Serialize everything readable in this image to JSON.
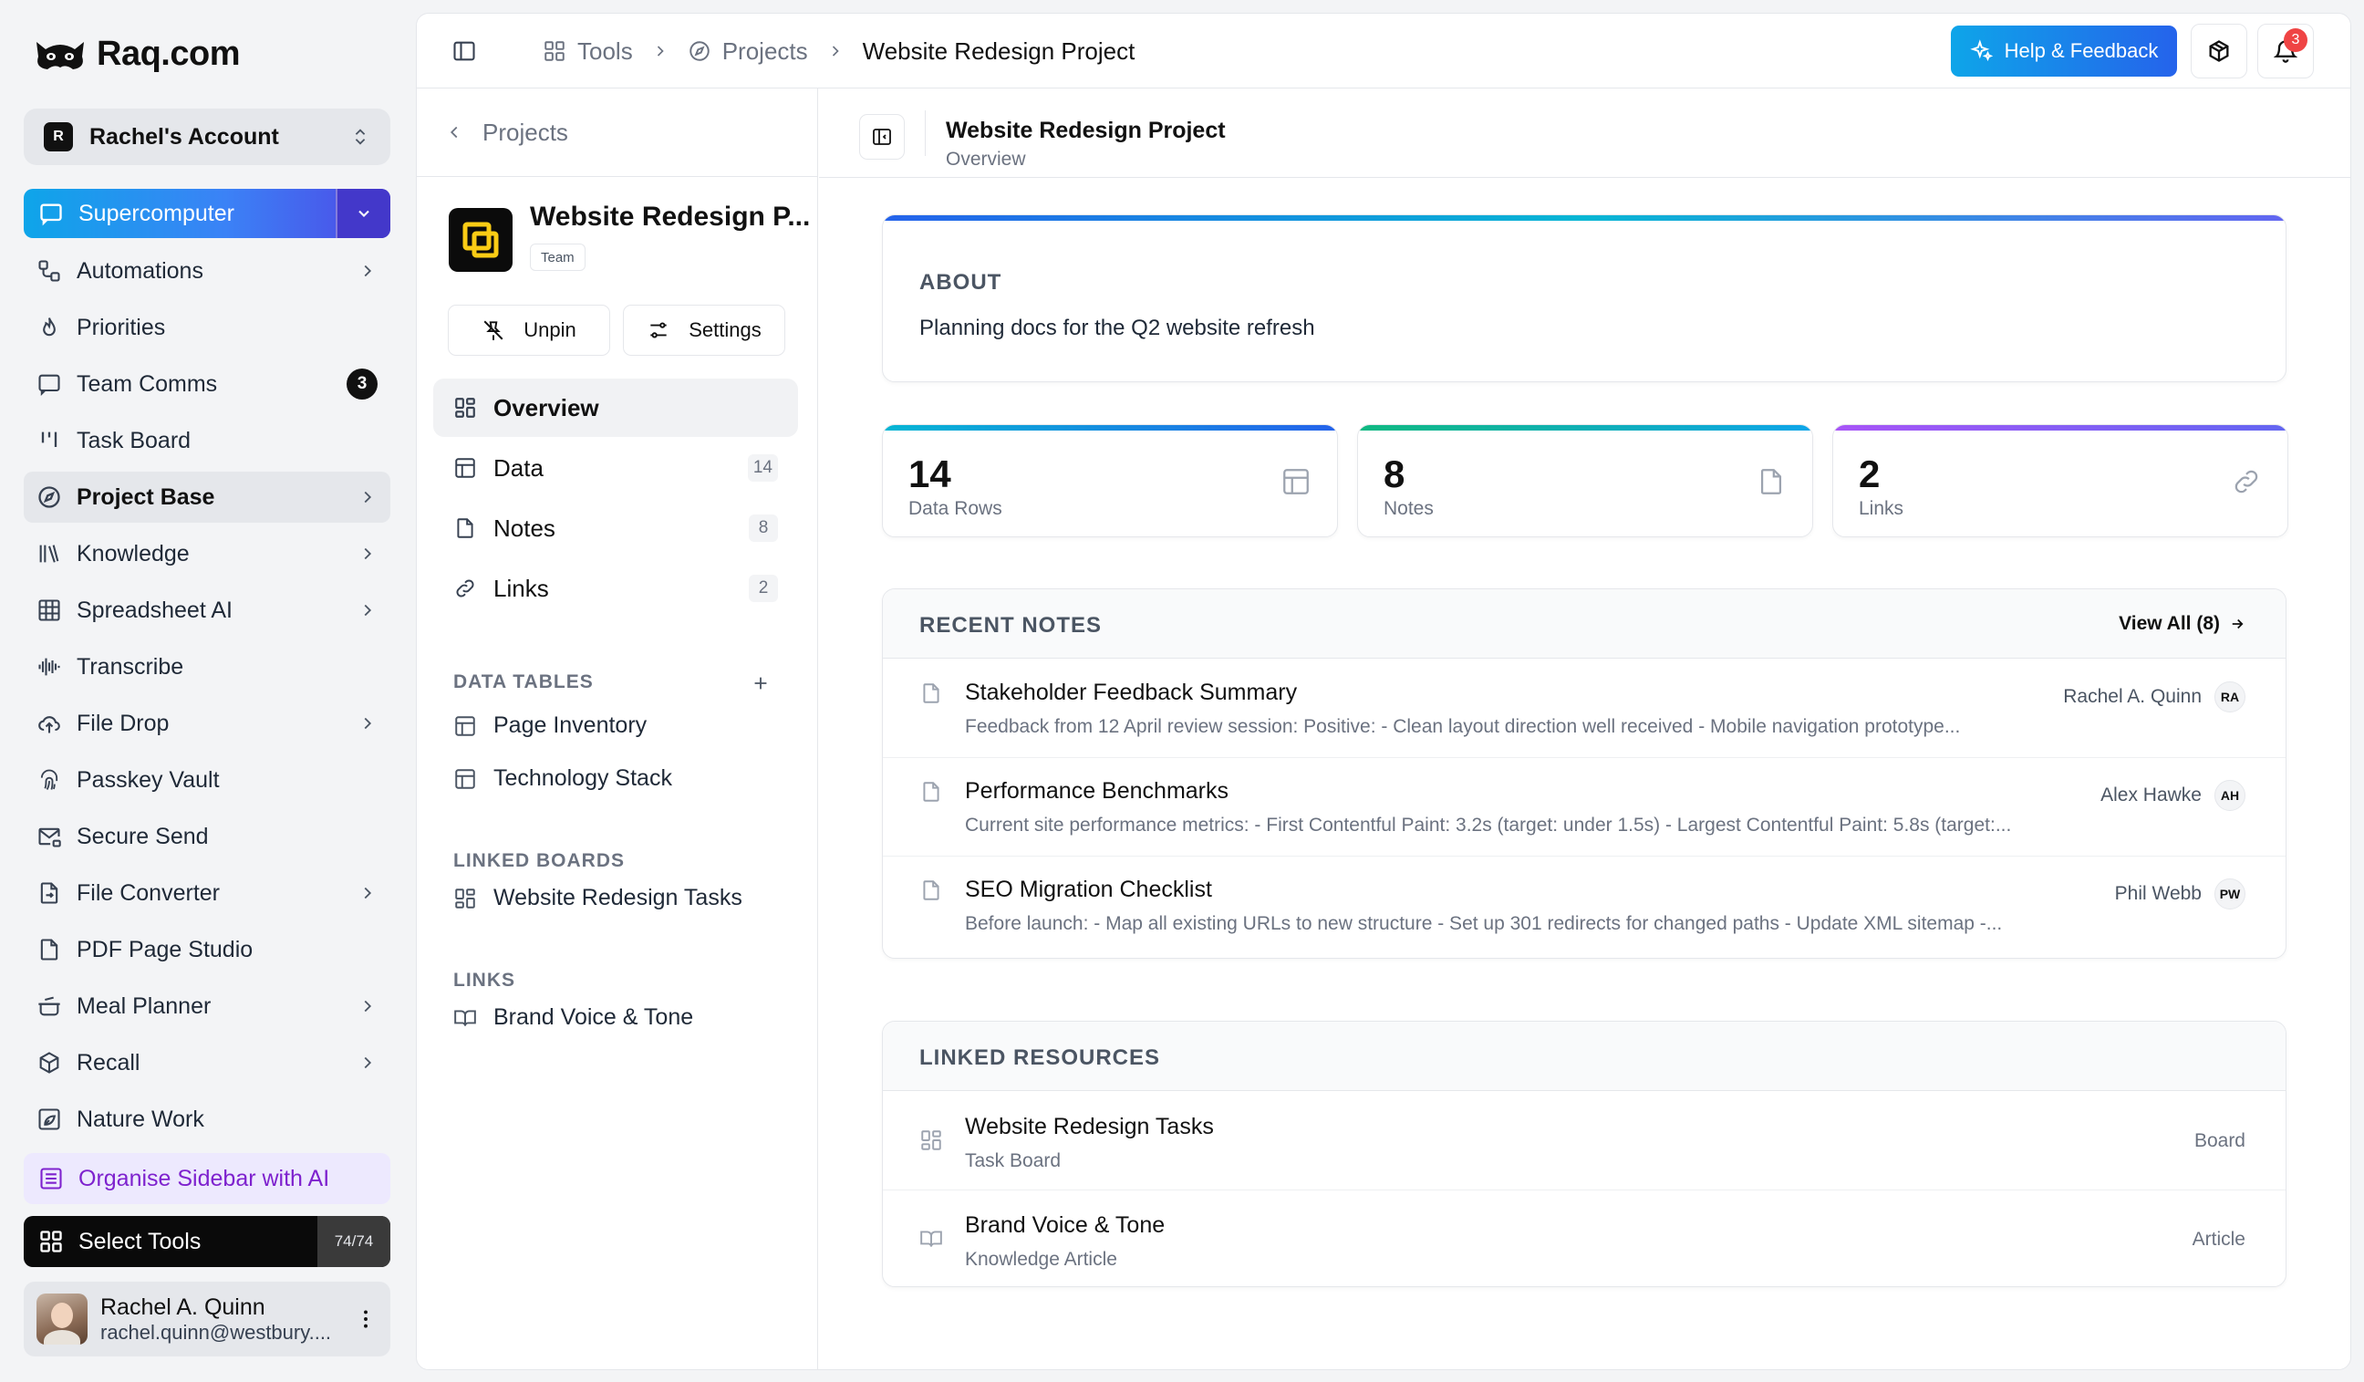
{
  "brand": {
    "name": "Raq.com"
  },
  "account": {
    "initial": "R",
    "name": "Rachel's Account"
  },
  "supercomputer": {
    "label": "Supercomputer"
  },
  "nav": [
    {
      "label": "Automations",
      "icon": "automations-icon",
      "chevron": true
    },
    {
      "label": "Priorities",
      "icon": "flame-icon",
      "chevron": false
    },
    {
      "label": "Team Comms",
      "icon": "chat-icon",
      "count": "3"
    },
    {
      "label": "Task Board",
      "icon": "kanban-icon",
      "chevron": false
    },
    {
      "label": "Project Base",
      "icon": "compass-icon",
      "chevron": true,
      "active": true
    },
    {
      "label": "Knowledge",
      "icon": "library-icon",
      "chevron": true
    },
    {
      "label": "Spreadsheet AI",
      "icon": "grid-icon",
      "chevron": true
    },
    {
      "label": "Transcribe",
      "icon": "waveform-icon",
      "chevron": false
    },
    {
      "label": "File Drop",
      "icon": "cloud-upload-icon",
      "chevron": true
    },
    {
      "label": "Passkey Vault",
      "icon": "fingerprint-icon",
      "chevron": false
    },
    {
      "label": "Secure Send",
      "icon": "mail-lock-icon",
      "chevron": false
    },
    {
      "label": "File Converter",
      "icon": "file-convert-icon",
      "chevron": true
    },
    {
      "label": "PDF Page Studio",
      "icon": "pdf-icon",
      "chevron": false
    },
    {
      "label": "Meal Planner",
      "icon": "cooking-pot-icon",
      "chevron": true
    },
    {
      "label": "Recall",
      "icon": "package-icon",
      "chevron": true
    },
    {
      "label": "Nature Work",
      "icon": "image-leaf-icon",
      "chevron": false
    }
  ],
  "organise": {
    "label": "Organise Sidebar with AI"
  },
  "select_tools": {
    "label": "Select Tools",
    "count": "74/74"
  },
  "user": {
    "name": "Rachel A. Quinn",
    "email": "rachel.quinn@westbury...."
  },
  "breadcrumbs": [
    {
      "label": "Tools"
    },
    {
      "label": "Projects"
    },
    {
      "label": "Website Redesign Project"
    }
  ],
  "help": {
    "label": "Help & Feedback"
  },
  "notifications": {
    "count": "3"
  },
  "project_side": {
    "back_label": "Projects",
    "title": "Website Redesign P...",
    "tag": "Team",
    "unpin_label": "Unpin",
    "settings_label": "Settings",
    "nav": [
      {
        "label": "Overview",
        "count": ""
      },
      {
        "label": "Data",
        "count": "14"
      },
      {
        "label": "Notes",
        "count": "8"
      },
      {
        "label": "Links",
        "count": "2"
      }
    ],
    "data_tables_heading": "DATA TABLES",
    "data_tables": [
      "Page Inventory",
      "Technology Stack"
    ],
    "linked_boards_heading": "LINKED BOARDS",
    "linked_boards": [
      "Website Redesign Tasks"
    ],
    "links_heading": "LINKS",
    "links": [
      "Brand Voice & Tone"
    ]
  },
  "content_header": {
    "title": "Website Redesign Project",
    "subtitle": "Overview"
  },
  "about": {
    "heading": "ABOUT",
    "text": "Planning docs for the Q2 website refresh"
  },
  "stats": [
    {
      "value": "14",
      "label": "Data Rows",
      "color": "#2563eb"
    },
    {
      "value": "8",
      "label": "Notes",
      "color": "#0d9488"
    },
    {
      "value": "2",
      "label": "Links",
      "color": "#8b5cf6"
    }
  ],
  "recent_notes": {
    "heading": "RECENT NOTES",
    "view_all": "View All (8)",
    "items": [
      {
        "title": "Stakeholder Feedback Summary",
        "preview": "Feedback from 12 April review session: Positive: - Clean layout direction well received - Mobile navigation prototype...",
        "author": "Rachel A. Quinn",
        "initials": "RA"
      },
      {
        "title": "Performance Benchmarks",
        "preview": "Current site performance metrics: - First Contentful Paint: 3.2s (target: under 1.5s) - Largest Contentful Paint: 5.8s (target:...",
        "author": "Alex Hawke",
        "initials": "AH"
      },
      {
        "title": "SEO Migration Checklist",
        "preview": "Before launch: - Map all existing URLs to new structure - Set up 301 redirects for changed paths - Update XML sitemap -...",
        "author": "Phil Webb",
        "initials": "PW"
      }
    ]
  },
  "linked_resources": {
    "heading": "LINKED RESOURCES",
    "items": [
      {
        "title": "Website Redesign Tasks",
        "subtitle": "Task Board",
        "kind": "Board"
      },
      {
        "title": "Brand Voice & Tone",
        "subtitle": "Knowledge Article",
        "kind": "Article"
      }
    ]
  }
}
